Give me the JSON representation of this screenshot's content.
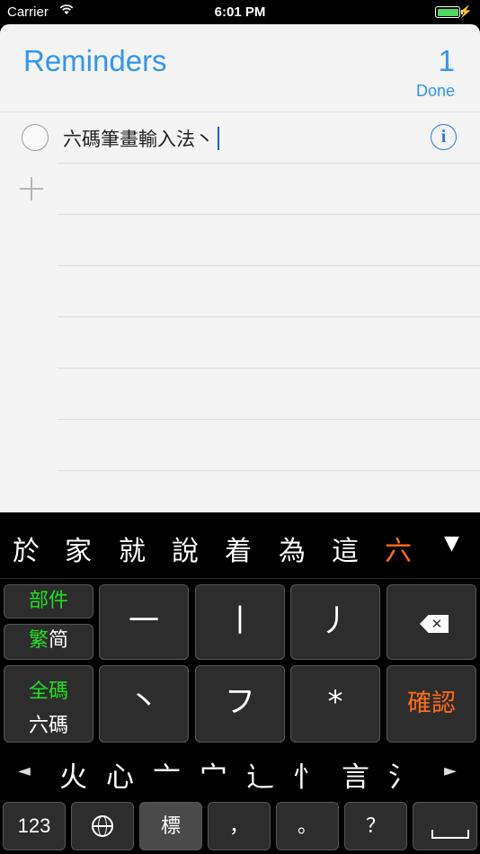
{
  "status_bar": {
    "carrier": "Carrier",
    "time": "6:01 PM"
  },
  "reminders": {
    "title": "Reminders",
    "count": "1",
    "done_label": "Done",
    "items": [
      {
        "text": "六碼筆畫輸入法丶"
      }
    ],
    "info_glyph": "i"
  },
  "keyboard": {
    "candidates": [
      "於",
      "家",
      "就",
      "說",
      "着",
      "為",
      "這",
      "六"
    ],
    "selected_candidate": "六",
    "more_glyph": "▼",
    "mode_keys": {
      "component": "部件",
      "trad": "繁",
      "simp": "简",
      "full_code": "全碼",
      "six_code": "六碼"
    },
    "stroke_keys": [
      "一",
      "丨",
      "丿",
      "丶",
      "フ",
      "*"
    ],
    "confirm_label": "確認",
    "delete_glyph": "✕",
    "radical_left": "◄",
    "radicals": [
      "火",
      "心",
      "亠",
      "宀",
      "辶",
      "忄",
      "言",
      "氵"
    ],
    "radical_right": "►",
    "bottom_row": {
      "numbers": "123",
      "biao": "標",
      "comma": "，",
      "period": "。",
      "question": "？"
    },
    "colors": {
      "accent_orange": "#ff6b1a",
      "accent_green": "#22dd22",
      "title_blue": "#3096f0"
    }
  }
}
